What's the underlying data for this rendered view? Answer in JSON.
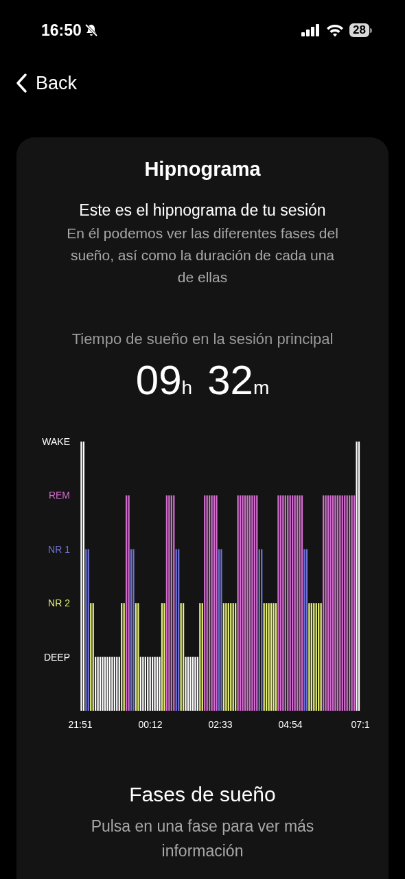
{
  "status_bar": {
    "time": "16:50",
    "battery": "28"
  },
  "nav": {
    "back_label": "Back"
  },
  "card": {
    "title": "Hipnograma",
    "subtitle": "Este es el hipnograma de tu sesión",
    "description": "En él podemos ver las diferentes fases del sueño, así como la duración de cada una de ellas",
    "duration_label": "Tiempo de sueño en la sesión principal",
    "hours": "09",
    "hours_unit": "h",
    "minutes": "32",
    "minutes_unit": "m",
    "hypnogram": {
      "stages": [
        {
          "label": "WAKE",
          "color": "#ffffff"
        },
        {
          "label": "REM",
          "color": "#d46dd0"
        },
        {
          "label": "NR 1",
          "color": "#6e72d8"
        },
        {
          "label": "NR 2",
          "color": "#e6f07a"
        },
        {
          "label": "DEEP",
          "color": "#ffffff"
        }
      ],
      "time_labels": [
        "21:51",
        "00:12",
        "02:33",
        "04:54",
        "07:1"
      ]
    }
  },
  "phases": {
    "title": "Fases de sueño",
    "hint": "Pulsa en una fase para ver más información"
  }
}
